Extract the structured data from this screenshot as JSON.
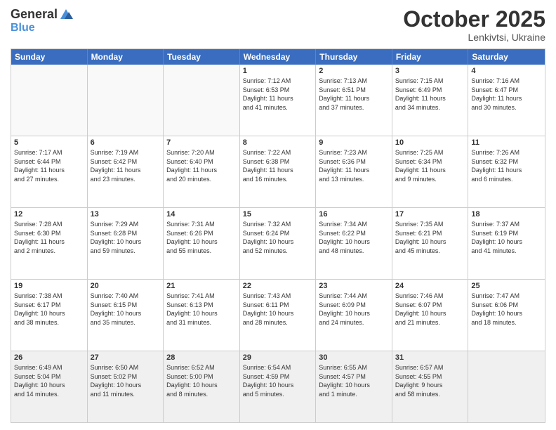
{
  "header": {
    "logo_general": "General",
    "logo_blue": "Blue",
    "month_title": "October 2025",
    "location": "Lenkivtsi, Ukraine"
  },
  "days_of_week": [
    "Sunday",
    "Monday",
    "Tuesday",
    "Wednesday",
    "Thursday",
    "Friday",
    "Saturday"
  ],
  "weeks": [
    [
      {
        "day": "",
        "info": ""
      },
      {
        "day": "",
        "info": ""
      },
      {
        "day": "",
        "info": ""
      },
      {
        "day": "1",
        "info": "Sunrise: 7:12 AM\nSunset: 6:53 PM\nDaylight: 11 hours\nand 41 minutes."
      },
      {
        "day": "2",
        "info": "Sunrise: 7:13 AM\nSunset: 6:51 PM\nDaylight: 11 hours\nand 37 minutes."
      },
      {
        "day": "3",
        "info": "Sunrise: 7:15 AM\nSunset: 6:49 PM\nDaylight: 11 hours\nand 34 minutes."
      },
      {
        "day": "4",
        "info": "Sunrise: 7:16 AM\nSunset: 6:47 PM\nDaylight: 11 hours\nand 30 minutes."
      }
    ],
    [
      {
        "day": "5",
        "info": "Sunrise: 7:17 AM\nSunset: 6:44 PM\nDaylight: 11 hours\nand 27 minutes."
      },
      {
        "day": "6",
        "info": "Sunrise: 7:19 AM\nSunset: 6:42 PM\nDaylight: 11 hours\nand 23 minutes."
      },
      {
        "day": "7",
        "info": "Sunrise: 7:20 AM\nSunset: 6:40 PM\nDaylight: 11 hours\nand 20 minutes."
      },
      {
        "day": "8",
        "info": "Sunrise: 7:22 AM\nSunset: 6:38 PM\nDaylight: 11 hours\nand 16 minutes."
      },
      {
        "day": "9",
        "info": "Sunrise: 7:23 AM\nSunset: 6:36 PM\nDaylight: 11 hours\nand 13 minutes."
      },
      {
        "day": "10",
        "info": "Sunrise: 7:25 AM\nSunset: 6:34 PM\nDaylight: 11 hours\nand 9 minutes."
      },
      {
        "day": "11",
        "info": "Sunrise: 7:26 AM\nSunset: 6:32 PM\nDaylight: 11 hours\nand 6 minutes."
      }
    ],
    [
      {
        "day": "12",
        "info": "Sunrise: 7:28 AM\nSunset: 6:30 PM\nDaylight: 11 hours\nand 2 minutes."
      },
      {
        "day": "13",
        "info": "Sunrise: 7:29 AM\nSunset: 6:28 PM\nDaylight: 10 hours\nand 59 minutes."
      },
      {
        "day": "14",
        "info": "Sunrise: 7:31 AM\nSunset: 6:26 PM\nDaylight: 10 hours\nand 55 minutes."
      },
      {
        "day": "15",
        "info": "Sunrise: 7:32 AM\nSunset: 6:24 PM\nDaylight: 10 hours\nand 52 minutes."
      },
      {
        "day": "16",
        "info": "Sunrise: 7:34 AM\nSunset: 6:22 PM\nDaylight: 10 hours\nand 48 minutes."
      },
      {
        "day": "17",
        "info": "Sunrise: 7:35 AM\nSunset: 6:21 PM\nDaylight: 10 hours\nand 45 minutes."
      },
      {
        "day": "18",
        "info": "Sunrise: 7:37 AM\nSunset: 6:19 PM\nDaylight: 10 hours\nand 41 minutes."
      }
    ],
    [
      {
        "day": "19",
        "info": "Sunrise: 7:38 AM\nSunset: 6:17 PM\nDaylight: 10 hours\nand 38 minutes."
      },
      {
        "day": "20",
        "info": "Sunrise: 7:40 AM\nSunset: 6:15 PM\nDaylight: 10 hours\nand 35 minutes."
      },
      {
        "day": "21",
        "info": "Sunrise: 7:41 AM\nSunset: 6:13 PM\nDaylight: 10 hours\nand 31 minutes."
      },
      {
        "day": "22",
        "info": "Sunrise: 7:43 AM\nSunset: 6:11 PM\nDaylight: 10 hours\nand 28 minutes."
      },
      {
        "day": "23",
        "info": "Sunrise: 7:44 AM\nSunset: 6:09 PM\nDaylight: 10 hours\nand 24 minutes."
      },
      {
        "day": "24",
        "info": "Sunrise: 7:46 AM\nSunset: 6:07 PM\nDaylight: 10 hours\nand 21 minutes."
      },
      {
        "day": "25",
        "info": "Sunrise: 7:47 AM\nSunset: 6:06 PM\nDaylight: 10 hours\nand 18 minutes."
      }
    ],
    [
      {
        "day": "26",
        "info": "Sunrise: 6:49 AM\nSunset: 5:04 PM\nDaylight: 10 hours\nand 14 minutes."
      },
      {
        "day": "27",
        "info": "Sunrise: 6:50 AM\nSunset: 5:02 PM\nDaylight: 10 hours\nand 11 minutes."
      },
      {
        "day": "28",
        "info": "Sunrise: 6:52 AM\nSunset: 5:00 PM\nDaylight: 10 hours\nand 8 minutes."
      },
      {
        "day": "29",
        "info": "Sunrise: 6:54 AM\nSunset: 4:59 PM\nDaylight: 10 hours\nand 5 minutes."
      },
      {
        "day": "30",
        "info": "Sunrise: 6:55 AM\nSunset: 4:57 PM\nDaylight: 10 hours\nand 1 minute."
      },
      {
        "day": "31",
        "info": "Sunrise: 6:57 AM\nSunset: 4:55 PM\nDaylight: 9 hours\nand 58 minutes."
      },
      {
        "day": "",
        "info": ""
      }
    ]
  ]
}
